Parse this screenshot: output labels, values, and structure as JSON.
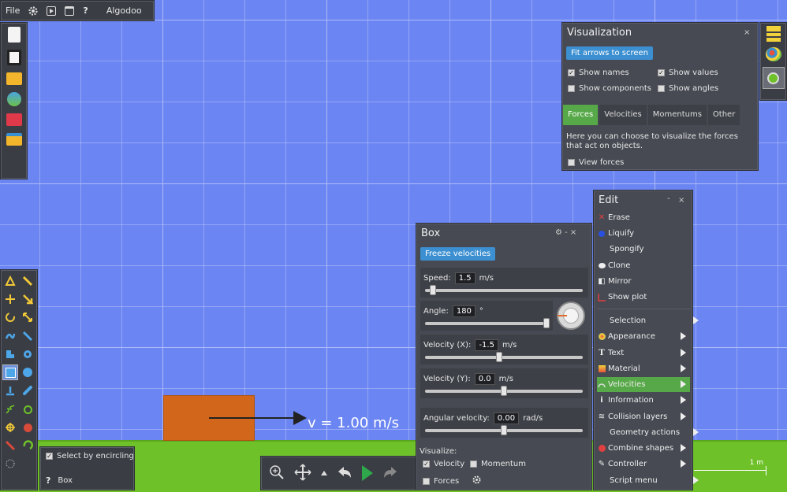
{
  "menubar": {
    "file": "File",
    "app": "Algodoo"
  },
  "scene": {
    "velocity_label": "v = 1.00 m/s",
    "scale_label": "1 m"
  },
  "selection": {
    "encircle": "Select by encircling",
    "object": "Box"
  },
  "visualization": {
    "title": "Visualization",
    "close": "×",
    "fit_button": "Fit arrows to screen",
    "show_names": "Show names",
    "show_values": "Show values",
    "show_components": "Show components",
    "show_angles": "Show angles",
    "tabs": [
      "Forces",
      "Velocities",
      "Momentums",
      "Other"
    ],
    "description": "Here you can choose to visualize the forces that act on objects.",
    "view_forces": "View forces"
  },
  "edit": {
    "title": "Edit",
    "minimize": "-",
    "close": "×",
    "items": [
      "Erase",
      "Liquify",
      "Spongify",
      "Clone",
      "Mirror",
      "Show plot"
    ],
    "submenus": [
      "Selection",
      "Appearance",
      "Text",
      "Material",
      "Velocities",
      "Information",
      "Collision layers",
      "Geometry actions",
      "Combine shapes",
      "Controller",
      "Script menu"
    ]
  },
  "box_panel": {
    "title": "Box",
    "controls": "⚙  -  ×",
    "freeze_button": "Freeze velocities",
    "speed": {
      "label": "Speed:",
      "value": "1.5",
      "unit": "m/s",
      "fraction": 0.05
    },
    "angle": {
      "label": "Angle:",
      "value": "180",
      "unit": "°",
      "fraction": 1.0
    },
    "vx": {
      "label": "Velocity (X):",
      "value": "-1.5",
      "unit": "m/s",
      "fraction": 0.47
    },
    "vy": {
      "label": "Velocity (Y):",
      "value": "0.0",
      "unit": "m/s",
      "fraction": 0.5
    },
    "ang": {
      "label": "Angular velocity:",
      "value": "0.00",
      "unit": "rad/s",
      "fraction": 0.5
    },
    "visualize_label": "Visualize:",
    "velocity": "Velocity",
    "momentum": "Momentum",
    "forces": "Forces"
  },
  "colors": {
    "accent_blue": "#3c8fd0",
    "active_green": "#57a848",
    "background": "#6b85f2",
    "ground": "#6fc12a",
    "box": "#d2661b"
  }
}
